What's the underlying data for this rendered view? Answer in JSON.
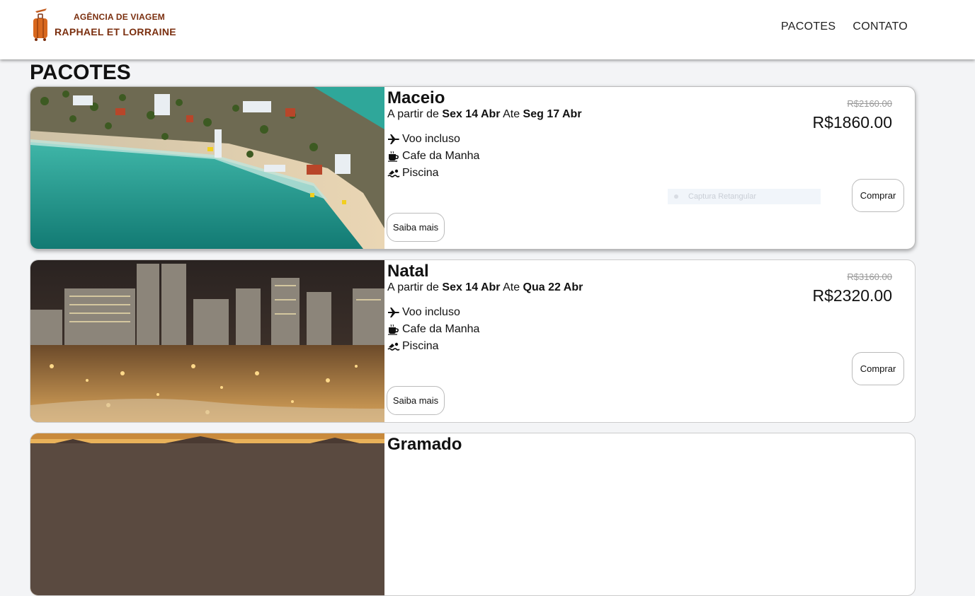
{
  "brand": {
    "line1": "AGÊNCIA DE VIAGEM",
    "line2": "RAPHAEL ET LORRAINE",
    "icon": "suitcase-airplane-logo"
  },
  "nav": {
    "items": [
      "PACOTES",
      "CONTATO"
    ]
  },
  "section_title": "PACOTES",
  "overlay_hint": "Captura Retangular",
  "colors": {
    "brand": "#7a2e0e",
    "background": "#f3f4f6"
  },
  "packages": [
    {
      "name": "Maceio",
      "date_prefix": "A partir de",
      "start": "Sex 14 Abr",
      "date_mid": "Ate",
      "end": "Seg 17 Abr",
      "features": [
        {
          "icon": "airplane-icon",
          "label": "Voo incluso"
        },
        {
          "icon": "coffee-icon",
          "label": "Cafe da Manha"
        },
        {
          "icon": "swimmer-icon",
          "label": "Piscina"
        }
      ],
      "old_price": "R$2160.00",
      "price": "R$1860.00",
      "buy_label": "Comprar",
      "more_label": "Saiba mais",
      "image": "beach-aerial-photo"
    },
    {
      "name": "Natal",
      "date_prefix": "A partir de",
      "start": "Sex 14 Abr",
      "date_mid": "Ate",
      "end": "Qua 22 Abr",
      "features": [
        {
          "icon": "airplane-icon",
          "label": "Voo incluso"
        },
        {
          "icon": "coffee-icon",
          "label": "Cafe da Manha"
        },
        {
          "icon": "swimmer-icon",
          "label": "Piscina"
        }
      ],
      "old_price": "R$3160.00",
      "price": "R$2320.00",
      "buy_label": "Comprar",
      "more_label": "Saiba mais",
      "image": "city-night-photo"
    },
    {
      "name": "Gramado",
      "image": "mountain-town-photo"
    }
  ]
}
